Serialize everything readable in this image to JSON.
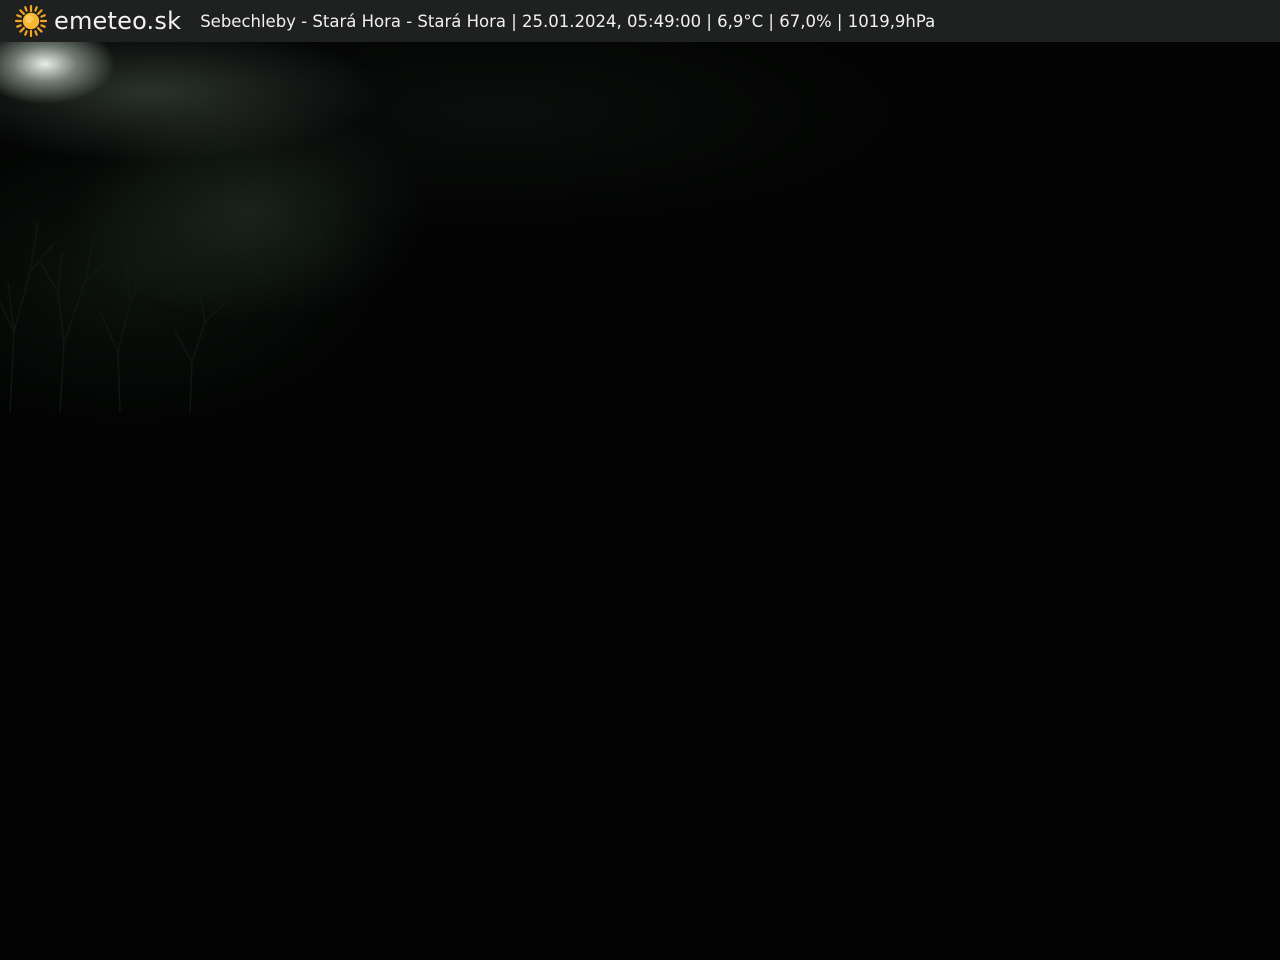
{
  "header": {
    "icon": "sun-icon",
    "brand": "emeteo.sk",
    "caption": "Sebechleby - Stará Hora - Stará Hora | 25.01.2024, 05:49:00 | 6,9°C | 67,0% | 1019,9hPa"
  },
  "colors": {
    "header_bg": "#1f2020",
    "sun": "#f5a623",
    "image_bg": "#020302"
  }
}
